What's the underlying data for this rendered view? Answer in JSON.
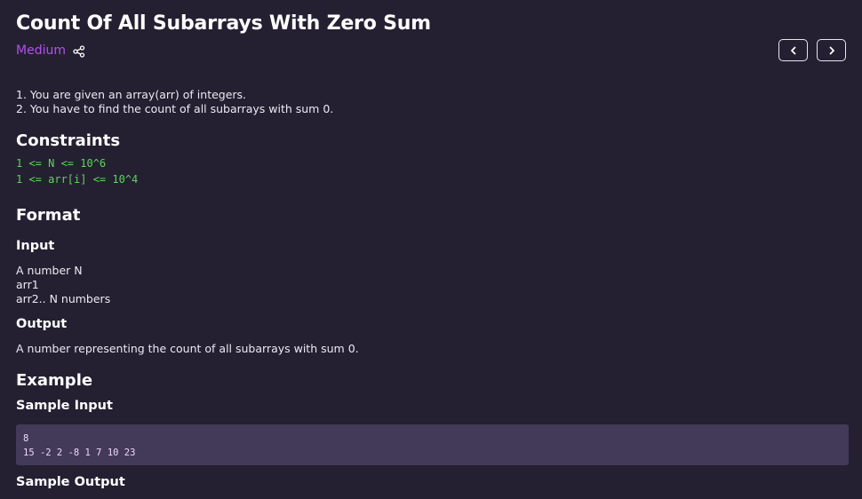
{
  "problem": {
    "title": "Count Of All Subarrays With Zero Sum",
    "difficulty": "Medium",
    "difficulty_color": "#b44ff0",
    "share_icon": "share-icon",
    "nav": {
      "prev_icon": "chevron-left-icon",
      "next_icon": "chevron-right-icon"
    },
    "description": [
      "1. You are given an array(arr) of integers.",
      "2. You have to find the count of all subarrays with sum 0."
    ],
    "constraints_heading": "Constraints",
    "constraints": [
      "1 <= N <= 10^6",
      "1 <= arr[i] <= 10^4"
    ],
    "format_heading": "Format",
    "input_heading": "Input",
    "input_lines": [
      "A number N",
      "arr1",
      "arr2.. N numbers"
    ],
    "output_heading": "Output",
    "output_text": "A number representing the count of all subarrays with sum 0.",
    "example_heading": "Example",
    "sample_input_heading": "Sample Input",
    "sample_input": [
      "8",
      "15 -2 2 -8 1 7 10 23"
    ],
    "sample_output_heading": "Sample Output"
  },
  "colors": {
    "background": "#242031",
    "accent": "#b44ff0",
    "constraint_green": "#5fd35f",
    "code_bg": "#433a59"
  }
}
